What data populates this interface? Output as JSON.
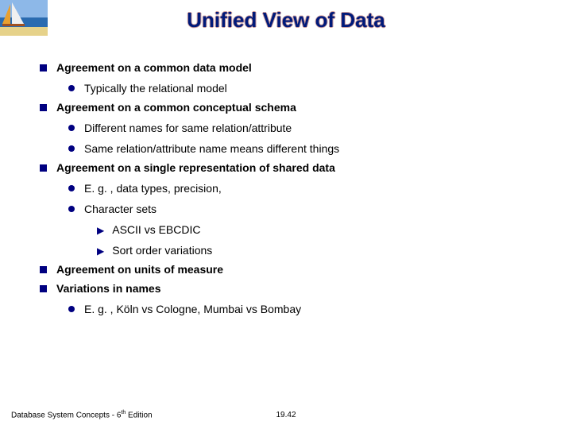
{
  "title": "Unified View of Data",
  "bullets": {
    "b1": "Agreement on a common data model",
    "b1_1": "Typically the relational model",
    "b2": "Agreement on a common conceptual schema",
    "b2_1": "Different names for same relation/attribute",
    "b2_2": "Same relation/attribute name means different things",
    "b3": "Agreement on a single representation of shared data",
    "b3_1": "E. g. , data types, precision,",
    "b3_2": "Character sets",
    "b3_2_1": "ASCII vs EBCDIC",
    "b3_2_2": "Sort order variations",
    "b4": "Agreement on units of measure",
    "b5": "Variations in names",
    "b5_1": "E. g. , Köln vs Cologne,  Mumbai vs Bombay"
  },
  "footer": {
    "left_pre": "Database System Concepts - 6",
    "left_sup": "th",
    "left_post": " Edition",
    "center": "19.42"
  }
}
